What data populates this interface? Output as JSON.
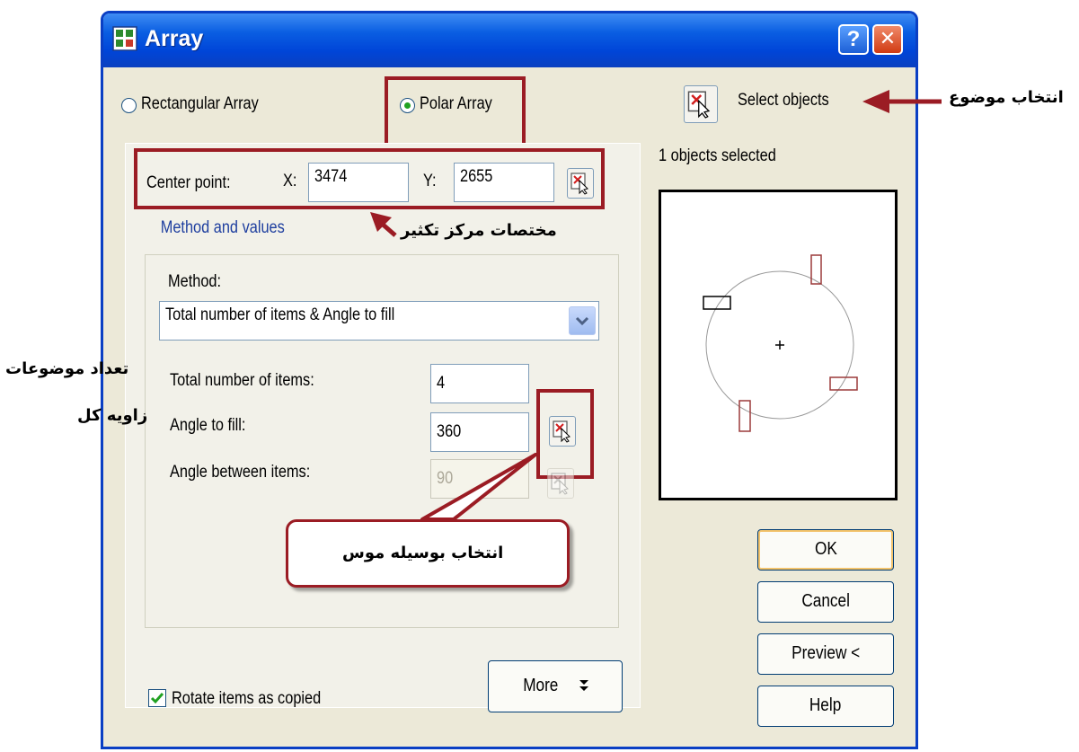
{
  "window": {
    "title": "Array",
    "help_glyph": "?",
    "close_glyph": "✕"
  },
  "array_type": {
    "rectangular_label": "Rectangular Array",
    "polar_label": "Polar Array",
    "selected": "Polar Array"
  },
  "center_point": {
    "label": "Center point:",
    "x_label": "X:",
    "x_value": "3474",
    "y_label": "Y:",
    "y_value": "2655"
  },
  "method_group": {
    "title": "Method and values",
    "method_label": "Method:",
    "method_value": "Total number of items & Angle to fill",
    "total_items_label": "Total number of items:",
    "total_items_value": "4",
    "angle_fill_label": "Angle to fill:",
    "angle_fill_value": "360",
    "angle_between_label": "Angle between items:",
    "angle_between_value": "90"
  },
  "select_objects": {
    "label": "Select objects",
    "status": "1 objects selected"
  },
  "rotate": {
    "label": "Rotate items as copied",
    "checked": true
  },
  "buttons": {
    "more": "More",
    "ok": "OK",
    "cancel": "Cancel",
    "preview": "Preview <",
    "help": "Help"
  },
  "annotations": {
    "select_object": "انتخاب موضوع",
    "center_coords": "مختصات مرکز تکثیر",
    "item_count": "تعداد موضوعات",
    "total_angle": "زاویه کل",
    "mouse_select": "انتخاب بوسیله موس"
  },
  "colors": {
    "title_bar": "#0a5ee2",
    "dialog_bg": "#ece9d8",
    "annotation_red": "#9b1c24",
    "group_title_blue": "#1f3f9f"
  },
  "icons": [
    "app-array-icon",
    "help-icon",
    "close-icon",
    "radio-icon",
    "pick-point-icon",
    "select-objects-icon",
    "chevron-down-icon",
    "double-chevron-down-icon",
    "checkbox-icon",
    "arrow-icon"
  ]
}
